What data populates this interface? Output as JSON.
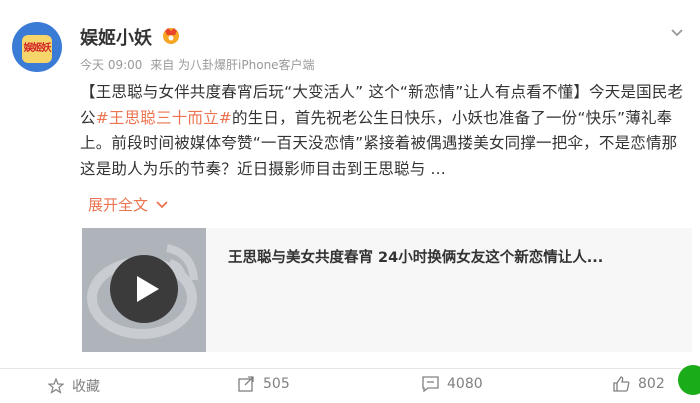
{
  "post": {
    "username": "娱姬小妖",
    "avatar_text": "娱姬妖",
    "meta_time": "今天 09:00",
    "meta_source": "来自 为八卦爆肝iPhone客户端",
    "content_part1": "【王思聪与女伴共度春宵后玩“大变活人” 这个“新恋情”让人有点看不懂】今天是国民老公",
    "content_topic": "#王思聪三十而立#",
    "content_part2": "的生日，首先祝老公生日快乐，小妖也准备了一份“快乐”薄礼奉上。前段时间被媒体夸赞“一百天没恋情”紧接着被偶遇搂美女同撑一把伞，不是恋情那这是助人为乐的节奏？近日摄影师目击到王思聪与 ...",
    "expand_label": "展开全文",
    "link_card_title": "王思聪与美女共度春宵 24小时换俩女友这个新恋情让人..."
  },
  "actions": {
    "favorite_label": "收藏",
    "repost_count": "505",
    "comment_count": "4080",
    "like_count": "802"
  },
  "colors": {
    "accent": "#eb7350",
    "text": "#333333",
    "meta": "#999999"
  }
}
